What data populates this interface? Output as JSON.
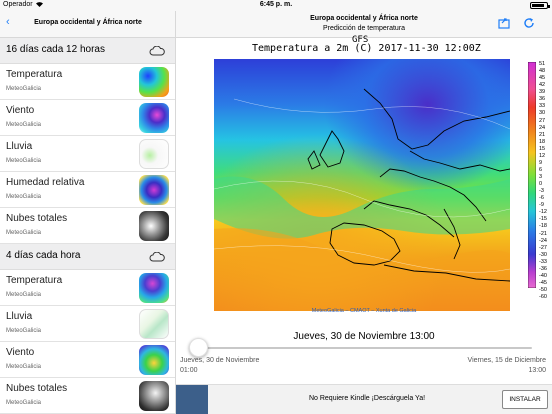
{
  "status_bar": {
    "carrier": "Operador",
    "time": "6:45 p. m."
  },
  "left_nav": {
    "back": "‹",
    "title": "Europa occidental y África norte"
  },
  "right_nav": {
    "title": "Europa occidental y África norte",
    "subtitle": "Predicción de temperatura"
  },
  "sidebar": {
    "sections": [
      {
        "title": "16 días cada 12 horas",
        "items": [
          {
            "name": "Temperatura",
            "source": "MeteoGalicia"
          },
          {
            "name": "Viento",
            "source": "MeteoGalicia"
          },
          {
            "name": "Lluvia",
            "source": "MeteoGalicia"
          },
          {
            "name": "Humedad relativa",
            "source": "MeteoGalicia"
          },
          {
            "name": "Nubes totales",
            "source": "MeteoGalicia"
          }
        ]
      },
      {
        "title": "4 días cada hora",
        "items": [
          {
            "name": "Temperatura",
            "source": "MeteoGalicia"
          },
          {
            "name": "Lluvia",
            "source": "MeteoGalicia"
          },
          {
            "name": "Viento",
            "source": "MeteoGalicia"
          },
          {
            "name": "Nubes totales",
            "source": "MeteoGalicia"
          }
        ]
      }
    ]
  },
  "map": {
    "model": "GFS",
    "title": "Temperatura a 2m (C) 2017-11-30 12:00Z",
    "colorbar_labels": [
      "51",
      "48",
      "45",
      "42",
      "39",
      "36",
      "33",
      "30",
      "27",
      "24",
      "21",
      "18",
      "15",
      "12",
      "9",
      "6",
      "3",
      "0",
      "-3",
      "-6",
      "-9",
      "-12",
      "-15",
      "-18",
      "-21",
      "-24",
      "-27",
      "-30",
      "-33",
      "-36",
      "-40",
      "-45",
      "-50",
      "-60"
    ],
    "credit": "MeteoGalicia – CMAOT – Xunta de Galicia"
  },
  "timeline": {
    "current": "Jueves, 30 de Noviembre 13:00",
    "position": 0.0,
    "start_date": "Jueves, 30 de Noviembre",
    "start_time": "01:00",
    "end_date": "Viernes, 15 de Diciembre",
    "end_time": "13:00"
  },
  "ad": {
    "text": "No Requiere Kindle ¡Descárguela Ya!",
    "button": "INSTALAR"
  },
  "colors": {
    "accent": "#1f7ef7"
  }
}
